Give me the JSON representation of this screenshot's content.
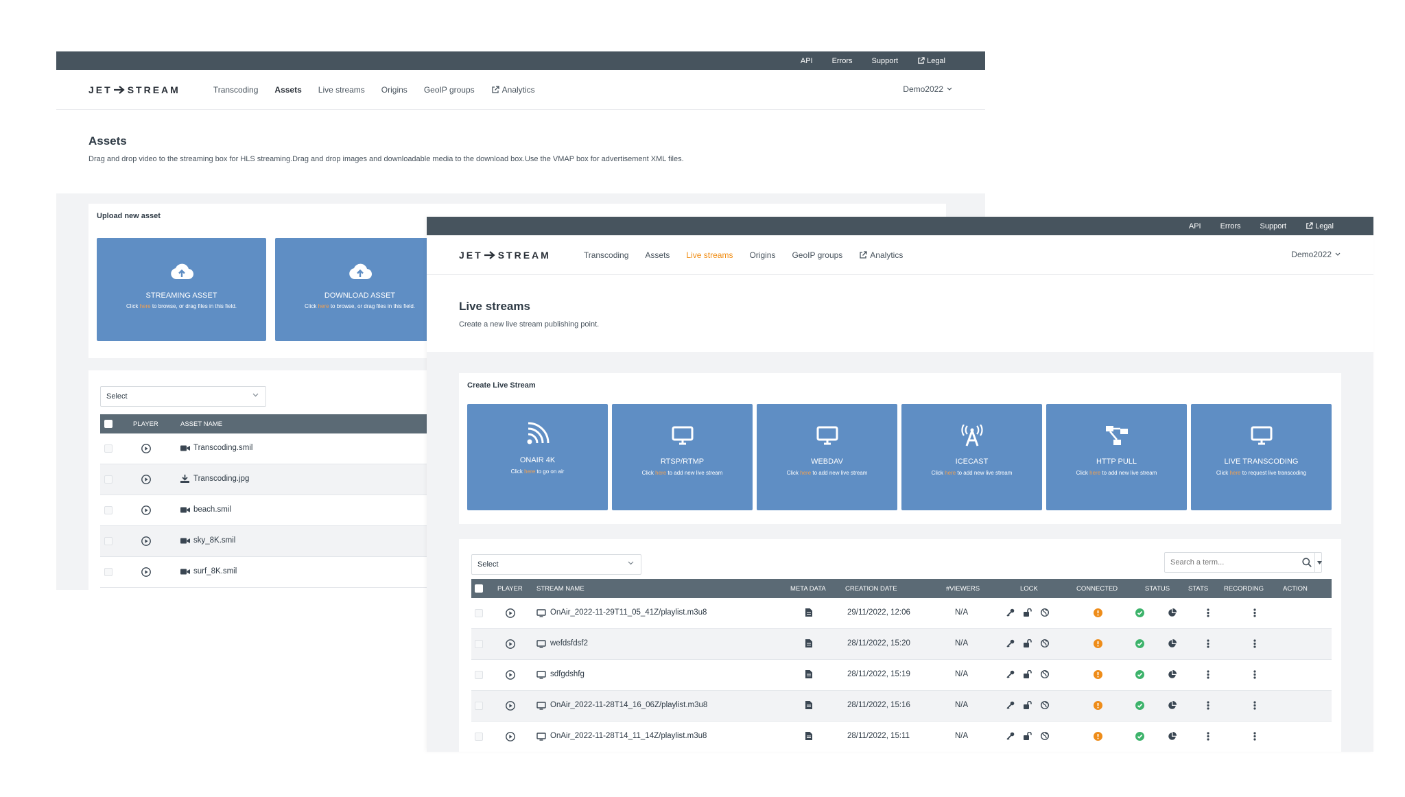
{
  "colors": {
    "topbar": "#47545e",
    "tile": "#5f8ec4",
    "accent": "#f08c12",
    "table_header": "#5b6a75",
    "status_ok": "#3db36b",
    "status_warn": "#ee8c19"
  },
  "topbar": {
    "api": "API",
    "errors": "Errors",
    "support": "Support",
    "legal": "Legal"
  },
  "brand": {
    "left": "JET",
    "right": "STREAM"
  },
  "nav": {
    "transcoding": "Transcoding",
    "assets": "Assets",
    "live_streams": "Live streams",
    "origins": "Origins",
    "geoip": "GeoIP groups",
    "analytics": "Analytics",
    "user": "Demo2022"
  },
  "assets_page": {
    "title": "Assets",
    "subtitle": "Drag and drop video to the streaming box for HLS streaming.Drag and drop images and downloadable media to the download box.Use the VMAP box for advertisement XML files.",
    "upload_title": "Upload new asset",
    "tiles": [
      {
        "label": "STREAMING ASSET",
        "desc_pre": "Click ",
        "here": "here",
        "desc_post": " to browse, or drag files in this field.",
        "icon": "cloud-upload-icon"
      },
      {
        "label": "DOWNLOAD ASSET",
        "desc_pre": "Click ",
        "here": "here",
        "desc_post": " to browse, or drag files in this field.",
        "icon": "cloud-upload-icon"
      }
    ],
    "select": "Select",
    "columns": {
      "player": "PLAYER",
      "name": "ASSET NAME"
    },
    "rows": [
      {
        "name": "Transcoding.smil",
        "icon": "video-camera-icon"
      },
      {
        "name": "Transcoding.jpg",
        "icon": "download-icon"
      },
      {
        "name": "beach.smil",
        "icon": "video-camera-icon"
      },
      {
        "name": "sky_8K.smil",
        "icon": "video-camera-icon"
      },
      {
        "name": "surf_8K.smil",
        "icon": "video-camera-icon"
      }
    ]
  },
  "live_page": {
    "title": "Live streams",
    "subtitle": "Create a new live stream publishing point.",
    "create_title": "Create Live Stream",
    "tiles": [
      {
        "label": "ONAIR 4K",
        "desc_pre": "Click ",
        "here": "here",
        "desc_post": " to go on air",
        "icon": "broadcast-signal-icon"
      },
      {
        "label": "RTSP/RTMP",
        "desc_pre": "Click ",
        "here": "here",
        "desc_post": " to add new live stream",
        "icon": "monitor-icon"
      },
      {
        "label": "WEBDAV",
        "desc_pre": "Click ",
        "here": "here",
        "desc_post": " to add new live stream",
        "icon": "monitor-icon"
      },
      {
        "label": "ICECAST",
        "desc_pre": "Click ",
        "here": "here",
        "desc_post": " to add new live stream",
        "icon": "antenna-icon"
      },
      {
        "label": "HTTP PULL",
        "desc_pre": "Click ",
        "here": "here",
        "desc_post": " to add new live stream",
        "icon": "network-icon"
      },
      {
        "label": "LIVE TRANSCODING",
        "desc_pre": "Click ",
        "here": "here",
        "desc_post": " to request live transcoding",
        "icon": "monitor-icon"
      }
    ],
    "select": "Select",
    "search_placeholder": "Search a term...",
    "columns": {
      "player": "PLAYER",
      "name": "STREAM NAME",
      "meta": "META DATA",
      "created": "CREATION DATE",
      "viewers": "#VIEWERS",
      "lock": "LOCK",
      "connected": "CONNECTED",
      "status": "STATUS",
      "stats": "STATS",
      "recording": "RECORDING",
      "action": "ACTION"
    },
    "rows": [
      {
        "name": "OnAir_2022-11-29T11_05_41Z/playlist.m3u8",
        "created": "29/11/2022, 12:06",
        "viewers": "N/A"
      },
      {
        "name": "wefdsfdsf2",
        "created": "28/11/2022, 15:20",
        "viewers": "N/A"
      },
      {
        "name": "sdfgdshfg",
        "created": "28/11/2022, 15:19",
        "viewers": "N/A"
      },
      {
        "name": "OnAir_2022-11-28T14_16_06Z/playlist.m3u8",
        "created": "28/11/2022, 15:16",
        "viewers": "N/A"
      },
      {
        "name": "OnAir_2022-11-28T14_11_14Z/playlist.m3u8",
        "created": "28/11/2022, 15:11",
        "viewers": "N/A"
      }
    ]
  }
}
